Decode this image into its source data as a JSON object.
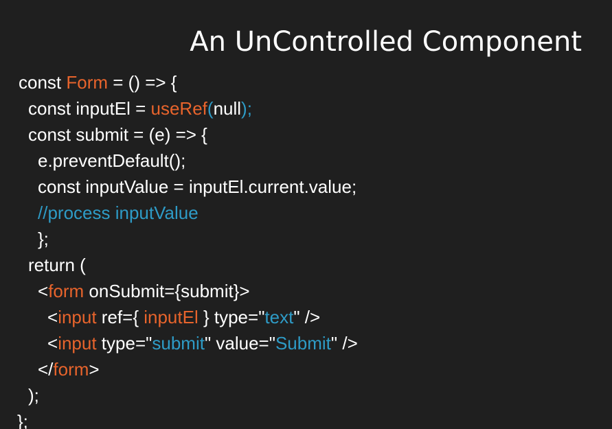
{
  "slide": {
    "title": "An UnControlled Component"
  },
  "colors": {
    "background": "#1f1f1f",
    "text": "#ffffff",
    "keyword_orange": "#e8642c",
    "string_blue": "#2e9bc6"
  },
  "code": {
    "lines": [
      {
        "indent": 0,
        "tokens": [
          {
            "text": "const ",
            "color": "white"
          },
          {
            "text": "Form",
            "color": "orange"
          },
          {
            "text": " = () => {",
            "color": "white"
          }
        ]
      },
      {
        "indent": 1,
        "tokens": [
          {
            "text": "const inputEl = ",
            "color": "white"
          },
          {
            "text": "useRef",
            "color": "orange"
          },
          {
            "text": "(",
            "color": "blue"
          },
          {
            "text": "null",
            "color": "white"
          },
          {
            "text": ");",
            "color": "blue"
          }
        ]
      },
      {
        "indent": 1,
        "tokens": [
          {
            "text": "const submit = (e) => {",
            "color": "white"
          }
        ]
      },
      {
        "indent": 2,
        "tokens": [
          {
            "text": "e.preventDefault();",
            "color": "white"
          }
        ]
      },
      {
        "indent": 2,
        "tokens": [
          {
            "text": "const inputValue = inputEl.current.value;",
            "color": "white"
          }
        ]
      },
      {
        "indent": 2,
        "tokens": [
          {
            "text": "//process inputValue",
            "color": "blue"
          }
        ]
      },
      {
        "indent": 2,
        "tokens": [
          {
            "text": "};",
            "color": "white"
          }
        ]
      },
      {
        "indent": 1,
        "tokens": [
          {
            "text": "return (",
            "color": "white"
          }
        ]
      },
      {
        "indent": 2,
        "tokens": [
          {
            "text": "<",
            "color": "white"
          },
          {
            "text": "form",
            "color": "orange"
          },
          {
            "text": " onSubmit={submit}>",
            "color": "white"
          }
        ]
      },
      {
        "indent": 3,
        "tokens": [
          {
            "text": "<",
            "color": "white"
          },
          {
            "text": "input",
            "color": "orange"
          },
          {
            "text": " ref={ ",
            "color": "white"
          },
          {
            "text": "inputEl",
            "color": "orange"
          },
          {
            "text": " } type=\"",
            "color": "white"
          },
          {
            "text": "text",
            "color": "blue"
          },
          {
            "text": "\" />",
            "color": "white"
          }
        ]
      },
      {
        "indent": 3,
        "tokens": [
          {
            "text": "<",
            "color": "white"
          },
          {
            "text": "input",
            "color": "orange"
          },
          {
            "text": " type=\"",
            "color": "white"
          },
          {
            "text": "submit",
            "color": "blue"
          },
          {
            "text": "\" value=\"",
            "color": "white"
          },
          {
            "text": "Submit",
            "color": "blue"
          },
          {
            "text": "\" />",
            "color": "white"
          }
        ]
      },
      {
        "indent": 2,
        "tokens": [
          {
            "text": "</",
            "color": "white"
          },
          {
            "text": "form",
            "color": "orange"
          },
          {
            "text": ">",
            "color": "white"
          }
        ]
      },
      {
        "indent": 1,
        "tokens": [
          {
            "text": ");",
            "color": "white"
          }
        ]
      },
      {
        "indent": 4,
        "tokens": [
          {
            "text": "};",
            "color": "white"
          }
        ]
      }
    ]
  }
}
